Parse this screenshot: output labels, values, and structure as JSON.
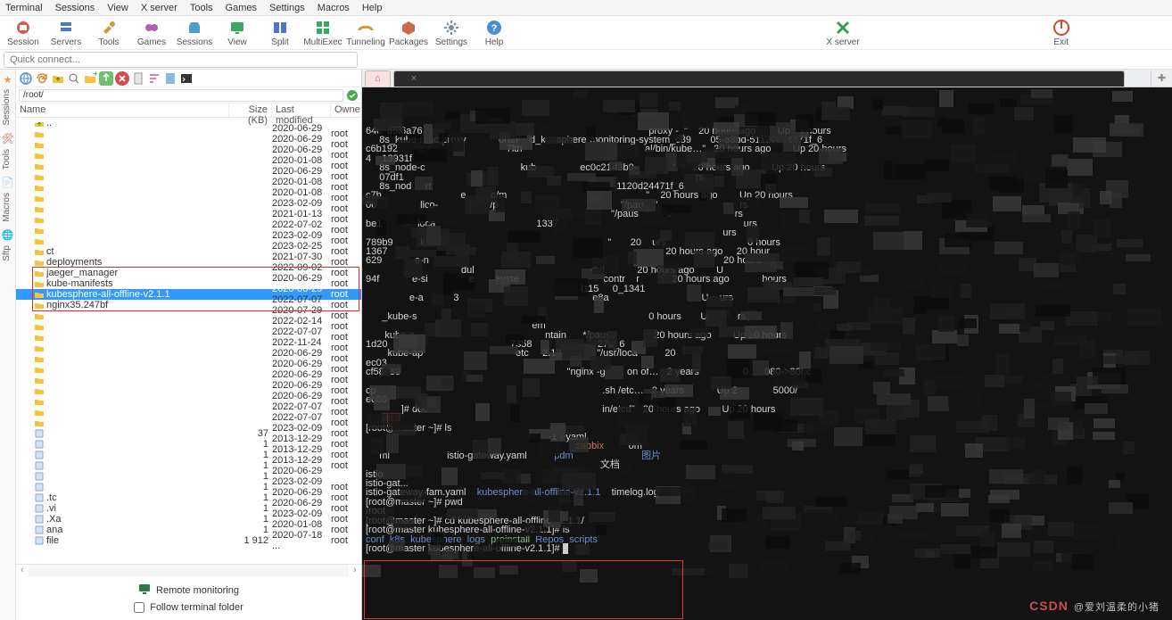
{
  "menu": [
    "Terminal",
    "Sessions",
    "View",
    "X server",
    "Tools",
    "Games",
    "Settings",
    "Macros",
    "Help"
  ],
  "tools": [
    {
      "id": "session",
      "label": "Session",
      "color": "#d0604a"
    },
    {
      "id": "servers",
      "label": "Servers",
      "color": "#4a77c9"
    },
    {
      "id": "tools",
      "label": "Tools",
      "color": "#d29a3a"
    },
    {
      "id": "games",
      "label": "Games",
      "color": "#b25fb0"
    },
    {
      "id": "sessions",
      "label": "Sessions",
      "color": "#4aa0c9"
    },
    {
      "id": "view",
      "label": "View",
      "color": "#3aa960"
    },
    {
      "id": "split",
      "label": "Split",
      "color": "#4a77c9"
    },
    {
      "id": "multiexec",
      "label": "MultiExec",
      "color": "#3aa960"
    },
    {
      "id": "tunneling",
      "label": "Tunneling",
      "color": "#d29a3a"
    },
    {
      "id": "packages",
      "label": "Packages",
      "color": "#c96a4a"
    },
    {
      "id": "settings",
      "label": "Settings",
      "color": "#7a8aa0"
    },
    {
      "id": "help",
      "label": "Help",
      "color": "#4a8cd6"
    }
  ],
  "tools_right": [
    {
      "id": "xserver",
      "label": "X server",
      "color": "#3a9a5a"
    },
    {
      "id": "exit",
      "label": "Exit",
      "color": "#cc4a3a"
    }
  ],
  "quick_connect": {
    "placeholder": "Quick connect..."
  },
  "sidestrip": [
    {
      "id": "sessions-tab",
      "label": "Sessions",
      "icon": "★",
      "color": "#e0a030"
    },
    {
      "id": "tools-tab",
      "label": "Tools",
      "icon": "🛠",
      "color": "#c05030"
    },
    {
      "id": "macros-tab",
      "label": "Macros",
      "icon": "📄",
      "color": "#555"
    },
    {
      "id": "sftp-tab",
      "label": "Sftp",
      "icon": "🌐",
      "color": "#3a76c0"
    }
  ],
  "path": "/root/",
  "file_header": {
    "name": "Name",
    "size": "Size (KB)",
    "mod": "Last modified",
    "own": "Owne"
  },
  "files": [
    {
      "t": "up",
      "n": "..",
      "s": "",
      "m": "",
      "o": ""
    },
    {
      "t": "d",
      "n": "",
      "s": "",
      "m": "2020-06-29 ...",
      "o": "root"
    },
    {
      "t": "d",
      "n": "",
      "s": "",
      "m": "2020-06-29 ...",
      "o": "root"
    },
    {
      "t": "d",
      "n": "",
      "s": "",
      "m": "2020-06-29 ...",
      "o": "root"
    },
    {
      "t": "d",
      "n": "",
      "s": "",
      "m": "2020-01-08 ...",
      "o": "root"
    },
    {
      "t": "d",
      "n": "",
      "s": "",
      "m": "2020-06-29 ...",
      "o": "root"
    },
    {
      "t": "d",
      "n": "",
      "s": "",
      "m": "2020-01-08 ...",
      "o": "root"
    },
    {
      "t": "d",
      "n": "",
      "s": "",
      "m": "2020-01-08 ...",
      "o": "root"
    },
    {
      "t": "d",
      "n": "",
      "s": "",
      "m": "2023-02-09 ...",
      "o": "root"
    },
    {
      "t": "d",
      "n": "",
      "s": "",
      "m": "2021-01-13 ...",
      "o": "root"
    },
    {
      "t": "d",
      "n": "",
      "s": "",
      "m": "2022-07-02 ...",
      "o": "root"
    },
    {
      "t": "d",
      "n": "",
      "s": "",
      "m": "2023-02-09 ...",
      "o": "root"
    },
    {
      "t": "d",
      "n": "ct",
      "s": "",
      "m": "2023-02-25 ...",
      "o": "root"
    },
    {
      "t": "d",
      "n": "deployments",
      "s": "",
      "m": "2021-07-30 ...",
      "o": "root"
    },
    {
      "t": "d",
      "n": "jaeger_manager",
      "s": "",
      "m": "2022-09-02 ...",
      "o": "root",
      "hl": 1
    },
    {
      "t": "d",
      "n": "kube-manifests",
      "s": "",
      "m": "2020-06-29 ...",
      "o": "root",
      "hl": 1
    },
    {
      "t": "d",
      "n": "kubesphere-all-offline-v2.1.1",
      "s": "",
      "m": "2020-06-29 ...",
      "o": "root",
      "sel": 1,
      "hl": 1
    },
    {
      "t": "d",
      "n": "nginx35.247bf",
      "s": "",
      "m": "2022-07-07 ...",
      "o": "root",
      "hl": 1
    },
    {
      "t": "d",
      "n": "",
      "s": "",
      "m": "2020-07-29 ...",
      "o": "root"
    },
    {
      "t": "d",
      "n": "",
      "s": "",
      "m": "2022-02-14 ...",
      "o": "root"
    },
    {
      "t": "d",
      "n": "",
      "s": "",
      "m": "2022-07-07 ...",
      "o": "root"
    },
    {
      "t": "d",
      "n": "",
      "s": "",
      "m": "2022-11-24 ...",
      "o": "root"
    },
    {
      "t": "d",
      "n": "",
      "s": "",
      "m": "2020-06-29 ...",
      "o": "root"
    },
    {
      "t": "d",
      "n": "",
      "s": "",
      "m": "2020-06-29 ...",
      "o": "root"
    },
    {
      "t": "d",
      "n": "",
      "s": "",
      "m": "2020-06-29 ...",
      "o": "root"
    },
    {
      "t": "d",
      "n": "",
      "s": "",
      "m": "2020-06-29 ...",
      "o": "root"
    },
    {
      "t": "d",
      "n": "",
      "s": "",
      "m": "2020-06-29 ...",
      "o": "root"
    },
    {
      "t": "d",
      "n": "",
      "s": "",
      "m": "2022-07-07 ...",
      "o": "root"
    },
    {
      "t": "d",
      "n": "",
      "s": "",
      "m": "2022-07-07 ...",
      "o": "root"
    },
    {
      "t": "f",
      "n": "",
      "s": "37",
      "m": "2023-02-09 ...",
      "o": "root"
    },
    {
      "t": "f",
      "n": "",
      "s": "1",
      "m": "2013-12-29 ...",
      "o": "root"
    },
    {
      "t": "f",
      "n": "",
      "s": "1",
      "m": "2013-12-29 ...",
      "o": "root"
    },
    {
      "t": "f",
      "n": "",
      "s": "1",
      "m": "2013-12-29 ...",
      "o": "root"
    },
    {
      "t": "f",
      "n": "",
      "s": "1",
      "m": "2020-06-29 ...",
      "o": ""
    },
    {
      "t": "f",
      "n": "",
      "s": "1",
      "m": "2023-02-09 ...",
      "o": "root"
    },
    {
      "t": "f",
      "n": ".tc",
      "s": "1",
      "m": "2020-06-29 ...",
      "o": "root"
    },
    {
      "t": "f",
      "n": ".vi",
      "s": "1",
      "m": "2020-06-29 ...",
      "o": "root"
    },
    {
      "t": "f",
      "n": ".Xa",
      "s": "1",
      "m": "2023-02-09 ...",
      "o": "root"
    },
    {
      "t": "f",
      "n": "ana",
      "s": "1",
      "m": "2020-01-08 ...",
      "o": "root"
    },
    {
      "t": "f",
      "n": "file",
      "s": "1 912",
      "m": "2020-07-18 ...",
      "o": "root"
    }
  ],
  "footer": {
    "remote": "Remote monitoring",
    "follow": "Follow terminal folder"
  },
  "tabs": {
    "home": "⌂",
    "active": "",
    "extra": ""
  },
  "terminal": {
    "top_rows": [
      "64c  d5f6a76                                                                                   proxy -_\"    20 hours ago        Up 20 hours",
      "     8s_kube-rbac-proxy            orter    d_k    sphere-monitoring-system_c89       05-a8bd-51120d24471f_6",
      "c6b192        k                              7lth                                             al/bin/kube…\"   20 hours ago        Up 20 hours",
      "4    13931f",
      "     8s_node-c                                   kub                ec0c21-f3b0-             \"      20 hours ago        Up 20 hours",
      "     07df1                                                                                                           rs",
      "     8s_nod     rt                                                                    1120d24471f_6",
      "c7b                             e         o/m                                                   \"    20 hours ago        Up 20 hours",
      "06                lico-                   /p                                             \"/pau    \"                              rs",
      "                                                                                          \"/paus   \"    20                       rs",
      "be1             loca                                     1337                                                                    urs",
      "                                                                                                                                   urs",
      "789b9          k    pri                                                           \"       20    urs                              0 hours",
      "1367                                                                                                      20 hours ago     20 hour",
      "629            e-n                                                                                                            20 hours",
      "                                   dul                                           dul            20 hours ago        U",
      "94f            e-si               e        syste                               contr    r            20 hours ago            hours",
      "                                                                               l115     0_1341",
      "                e-a           3                                                 e8a                                  U    urs",
      "                                                                                                                             ",
      "      _kube-s                                                                                     0 hours       U           rs",
      "                                                             em",
      "       kube-c                                                ntain      */pause              20 hours ago        Up 20 hours",
      "1d20                                             7358                        27d_6",
      "        kube-ap                                  etc     2.18             \"/usr/loca          20",
      "ec03                                                                                                                              ",
      "cf58  89                                                             \"nginx -g        on of…   2 years                0.     080->80/tc",
      "                                                                                                                                      ",
      "cp                                                                                   .sh /etc…   2 years            Up 2             5000/",
      "ec03                                                                                                          ",
      "             ]# doc                                                                in/etcd\"   20 hours ago        Up 20 hours"
    ],
    "ls_block": [
      "[root@master ~]# ls",
      "                                                                   -1 - yaml",
      "                                                                             zabbix         om",
      "",
      "     ml                     istio-gateway.yaml          pdm                         图片",
      "                                                                                      文档",
      "istio",
      "istio-gat...                                                              ",
      "istio-gateway-fam.yaml    kubesphere-all-offline-v2.1.1    timelog.log"
    ],
    "boxed": [
      "[root@master ~]# pwd",
      "/root",
      "[root@master ~]# cd kubesphere-all-offline-v2.1.1/",
      "[root@master kubesphere-all-offline-v2.1.1]# ls",
      "conf  k8s  kubesphere  logs  preinstall  Repos  scripts",
      "[root@master kubesphere-all-offline-v2.1.1]# "
    ],
    "etcd_word": "etcd"
  },
  "watermark": {
    "logo": "CSDN",
    "text": "@爱刘温柔的小猪"
  }
}
